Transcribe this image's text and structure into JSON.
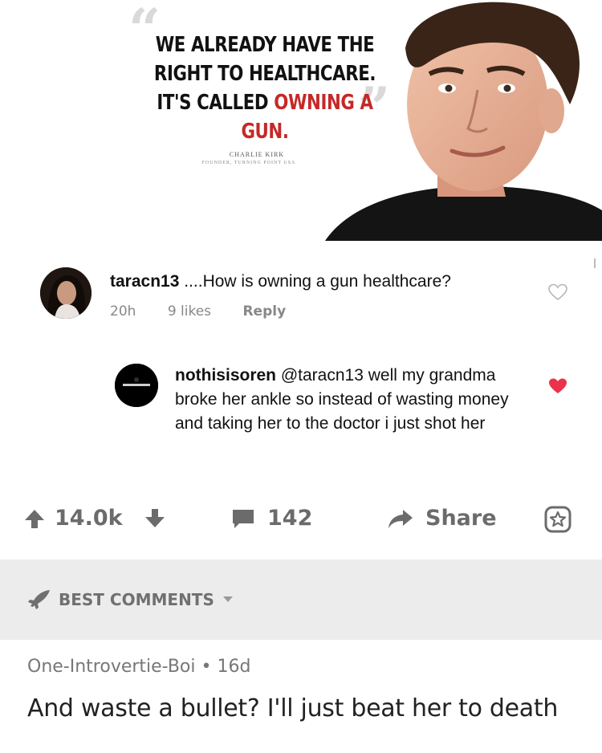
{
  "quote_card": {
    "line1": "WE ALREADY HAVE THE",
    "line2": "RIGHT TO HEALTHCARE.",
    "line3_prefix": "IT'S CALLED ",
    "line3_highlight": "OWNING A GUN.",
    "author": "CHARLIE KIRK",
    "author_subtitle": "FOUNDER, TURNING POINT USA",
    "highlight_color": "#c62828"
  },
  "comment_1": {
    "username": "taracn13",
    "text": " ....How is owning a gun healthcare?",
    "time": "20h",
    "likes": "9 likes",
    "reply_label": "Reply",
    "heart_icon": "heart-outline-icon"
  },
  "comment_2": {
    "username": "nothisisoren",
    "text": " @taracn13 well my grandma broke her ankle so instead of wasting money and taking her to the doctor i just shot her",
    "heart_icon": "heart-filled-icon",
    "heart_color": "#e8334a"
  },
  "actions": {
    "upvotes": "14.0k",
    "comments": "142",
    "share_label": "Share"
  },
  "best_comments": {
    "label": "BEST COMMENTS"
  },
  "bottom_comment": {
    "author": "One-Introvertie-Boi",
    "separator": " • ",
    "age": "16d",
    "text": "And waste a bullet? I'll just beat her to death"
  }
}
